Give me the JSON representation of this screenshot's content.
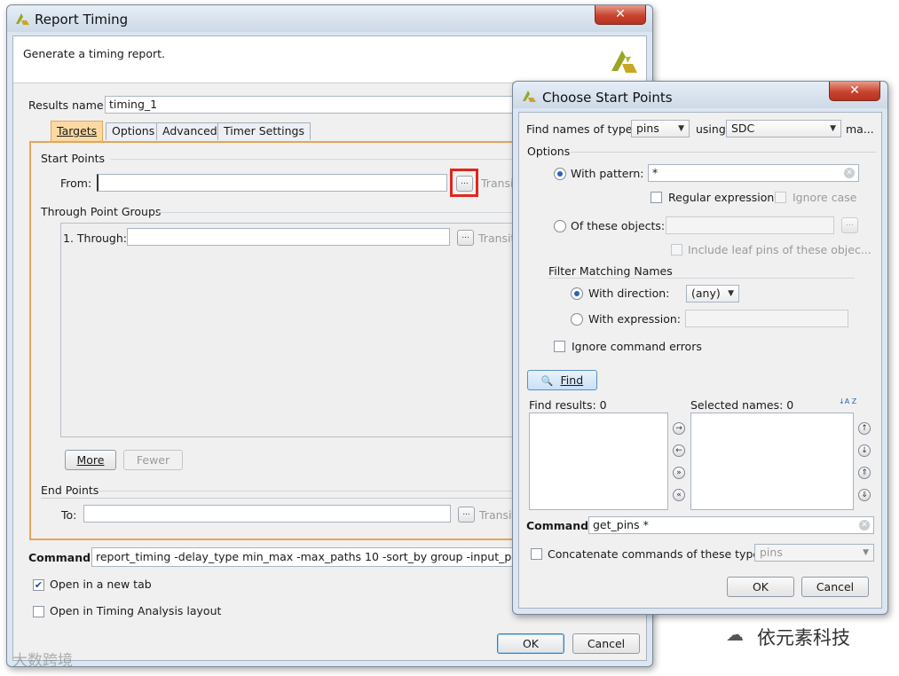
{
  "report_timing": {
    "title": "Report Timing",
    "close_label": "✕",
    "header_text": "Generate a timing report.",
    "results_name_label": "Results name:",
    "results_name_value": "timing_1",
    "tabs": [
      "Targets",
      "Options",
      "Advanced",
      "Timer Settings"
    ],
    "start_points": {
      "section_label": "Start Points",
      "from_label": "From:",
      "from_value": "",
      "browse_label": "...",
      "transition_label": "Transiti"
    },
    "through": {
      "section_label": "Through Point Groups",
      "item_label": "1. Through:",
      "item_value": "",
      "browse_label": "...",
      "transition_label": "Transiti"
    },
    "more_label": "More",
    "fewer_label": "Fewer",
    "end_points": {
      "section_label": "End Points",
      "to_label": "To:",
      "to_value": "",
      "browse_label": "...",
      "transition_label": "Transiti"
    },
    "command_label": "Command:",
    "command_value": "report_timing -delay_type min_max -max_paths 10 -sort_by group -input_pins -na",
    "open_new_tab_label": "Open in a new tab",
    "open_new_tab_checked": true,
    "open_timing_layout_label": "Open in Timing Analysis layout",
    "open_timing_layout_checked": false,
    "ok_label": "OK",
    "cancel_label": "Cancel"
  },
  "choose_start_points": {
    "title": "Choose Start Points",
    "close_label": "✕",
    "find_names_label": "Find names of type:",
    "type_value": "pins",
    "using_label": "using",
    "using_value": "SDC",
    "trailing_label": "ma...",
    "options_label": "Options",
    "with_pattern_label": "With pattern:",
    "with_pattern_value": "*",
    "regular_expression_label": "Regular expression",
    "ignore_case_label": "Ignore case",
    "of_these_objects_label": "Of these objects:",
    "of_these_objects_value": "",
    "browse_label": "...",
    "include_leaf_pins_label": "Include leaf pins of these objec...",
    "filter_matching_label": "Filter Matching Names",
    "with_direction_label": "With direction:",
    "direction_value": "(any)",
    "with_expression_label": "With expression:",
    "with_expression_value": "",
    "ignore_errors_label": "Ignore command errors",
    "find_button_label": "Find",
    "find_results_label": "Find results: 0",
    "selected_names_label": "Selected names: 0",
    "sort_icon_label": "↓A Z",
    "command_label": "Command:",
    "command_value": "get_pins *",
    "concatenate_label": "Concatenate commands of these types:",
    "concatenate_value": "pins",
    "ok_label": "OK",
    "cancel_label": "Cancel"
  },
  "watermark": {
    "left_text": "大数跨境",
    "right_text": "依元素科技"
  },
  "colors": {
    "accent_orange": "#e6a556",
    "highlight_red": "#e0261d",
    "selection_blue": "#2b62b8"
  }
}
